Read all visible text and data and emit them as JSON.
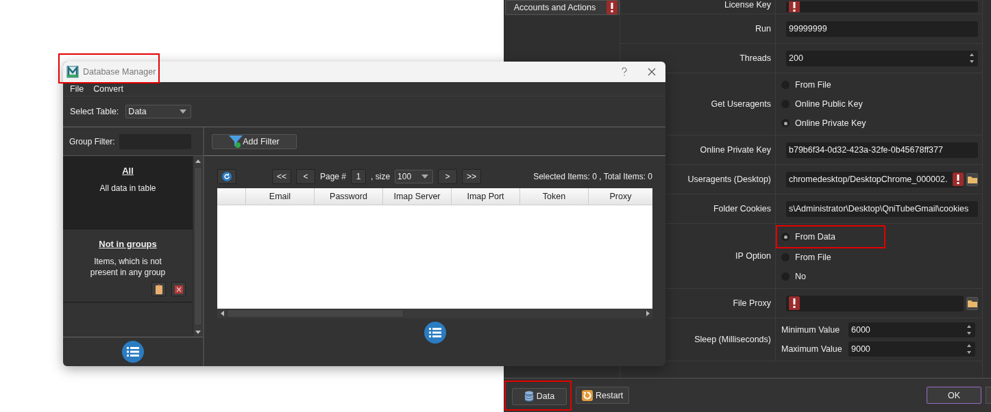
{
  "settings_window": {
    "sidebar_items": [
      {
        "label": "Accounts and Actions",
        "error": true
      }
    ],
    "rows": [
      {
        "kind": "text",
        "label": "License Key",
        "value": "",
        "error": true,
        "cut": true
      },
      {
        "kind": "text",
        "label": "Run",
        "value": "99999999"
      },
      {
        "kind": "spin",
        "label": "Threads",
        "value": "200"
      },
      {
        "kind": "radio",
        "label": "Get Useragents",
        "options": [
          {
            "label": "From File",
            "selected": false
          },
          {
            "label": "Online Public Key",
            "selected": false
          },
          {
            "label": "Online Private Key",
            "selected": true
          }
        ]
      },
      {
        "kind": "text",
        "label": "Online Private Key",
        "value": "b79b6f34-0d32-423a-32fe-0b45678ff377"
      },
      {
        "kind": "text",
        "label": "Useragents (Desktop)",
        "value": "chromedesktop/DesktopChrome_000002.",
        "error": true,
        "browse": true
      },
      {
        "kind": "text",
        "label": "Folder Cookies",
        "value": "s\\Administrator\\Desktop\\QniTubeGmail\\cookies"
      },
      {
        "kind": "radio",
        "label": "IP Option",
        "options": [
          {
            "label": "From Data",
            "selected": true,
            "highlighted": true
          },
          {
            "label": "From File",
            "selected": false
          },
          {
            "label": "No",
            "selected": false
          }
        ]
      },
      {
        "kind": "text",
        "label": "File Proxy",
        "value": "",
        "error": true,
        "browse": true
      },
      {
        "kind": "minmax",
        "label": "Sleep (Milliseconds)",
        "spins": [
          {
            "label": "Minimum Value",
            "value": "6000"
          },
          {
            "label": "Maximum Value",
            "value": "9000"
          }
        ]
      }
    ],
    "buttons": [
      {
        "kind": "data",
        "label": "Data",
        "highlighted": true
      },
      {
        "kind": "restart",
        "label": "Restart"
      },
      {
        "kind": "ok",
        "label": "OK",
        "right": true
      }
    ]
  },
  "dialog": {
    "title": "Database Manager",
    "highlighted": true,
    "menu": [
      "File",
      "Convert"
    ],
    "select_table": {
      "label": "Select Table:",
      "value": "Data"
    },
    "group_filter": {
      "label": "Group Filter:"
    },
    "groups": [
      {
        "title": "All",
        "description": "All data in table",
        "selected": true
      },
      {
        "title": "Not in groups",
        "description": "Items, which is not present in any group",
        "selected": false,
        "actions": true
      }
    ],
    "add_filter": "Add Filter",
    "pager": {
      "first": "<<",
      "prev": "<",
      "page_label": "Page #",
      "page": "1",
      "size_label": ", size",
      "size": "100",
      "next": ">",
      "last": ">>",
      "status": "Selected Items:  0 , Total Items:  0"
    },
    "table": {
      "columns": [
        "Email",
        "Password",
        "Imap Server",
        "Imap Port",
        "Token",
        "Proxy"
      ]
    }
  }
}
